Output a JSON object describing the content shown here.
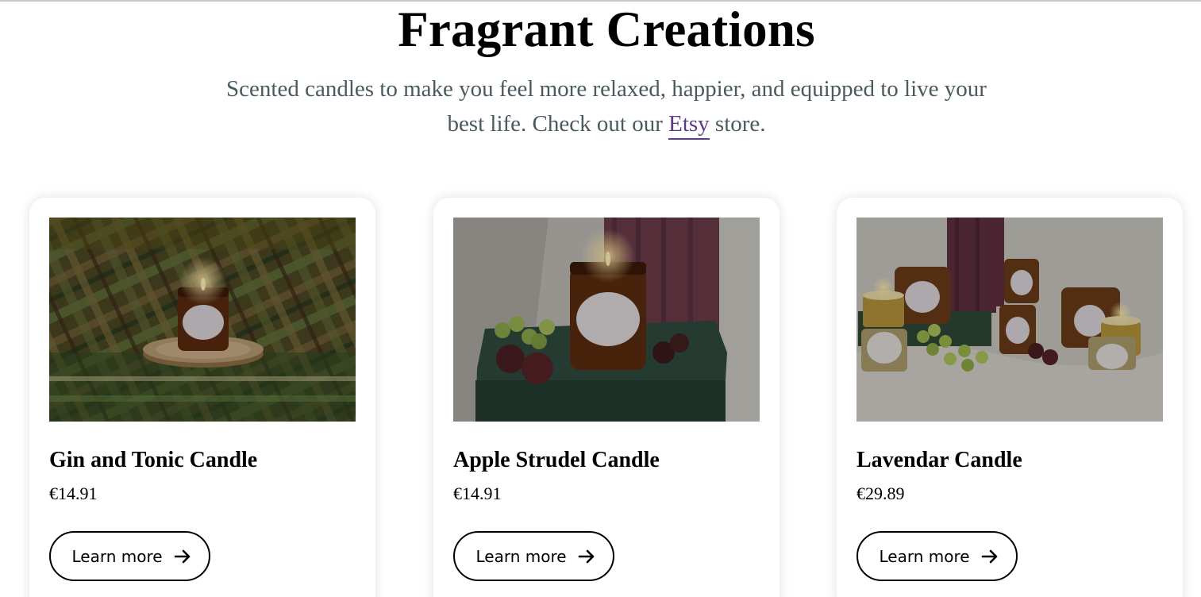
{
  "header": {
    "title": "Fragrant Creations",
    "intro_before_link": "Scented candles to make you feel more relaxed, happier, and equipped to live your best life. Check out our ",
    "intro_link": "Etsy",
    "intro_after_link": " store."
  },
  "products": [
    {
      "name": "Gin and Tonic Candle",
      "price": "€14.91",
      "button_label": "Learn more",
      "image_icon": "candle-photo-tartan-blanket"
    },
    {
      "name": "Apple Strudel Candle",
      "price": "€14.91",
      "button_label": "Learn more",
      "image_icon": "candle-photo-grapes-book"
    },
    {
      "name": "Lavendar Candle",
      "price": "€29.89",
      "button_label": "Learn more",
      "image_icon": "candle-photo-group-arrangement"
    }
  ],
  "colors": {
    "intro_text": "#4a5a5f",
    "link": "#5b3a86",
    "card_background": "#ffffff"
  }
}
